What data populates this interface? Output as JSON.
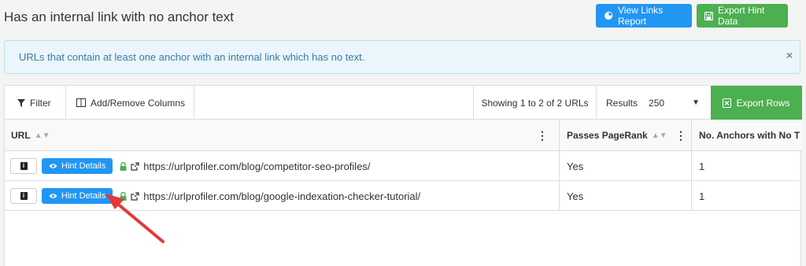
{
  "header": {
    "title": "Has an internal link with no anchor text",
    "view_links_label": "View Links Report",
    "export_hint_label": "Export Hint Data"
  },
  "info_box": {
    "text": "URLs that contain at least one anchor with an internal link which has no text.",
    "close": "×"
  },
  "toolbar": {
    "filter_label": "Filter",
    "columns_label": "Add/Remove Columns",
    "showing_text": "Showing 1 to 2 of 2 URLs",
    "results_label": "Results",
    "results_value": "250",
    "export_rows_label": "Export Rows"
  },
  "table": {
    "columns": [
      "URL",
      "Passes PageRank",
      "No. Anchors with No T"
    ],
    "rows": [
      {
        "hint_label": "Hint Details",
        "url": "https://urlprofiler.com/blog/competitor-seo-profiles/",
        "passes_pagerank": "Yes",
        "anchors": "1"
      },
      {
        "hint_label": "Hint Details",
        "url": "https://urlprofiler.com/blog/google-indexation-checker-tutorial/",
        "passes_pagerank": "Yes",
        "anchors": "1"
      }
    ]
  },
  "icons": {
    "pie": "pie-chart-icon",
    "save": "save-icon",
    "filter": "filter-icon",
    "columns": "columns-icon",
    "excel": "excel-icon",
    "eye": "eye-icon",
    "lock": "lock-icon",
    "external": "external-link-icon",
    "arrow": "annotation-arrow"
  },
  "colors": {
    "primary": "#2196f3",
    "success": "#4caf50",
    "info_bg": "#eaf6fb",
    "info_text": "#3a7ca5",
    "arrow": "#e53935"
  }
}
